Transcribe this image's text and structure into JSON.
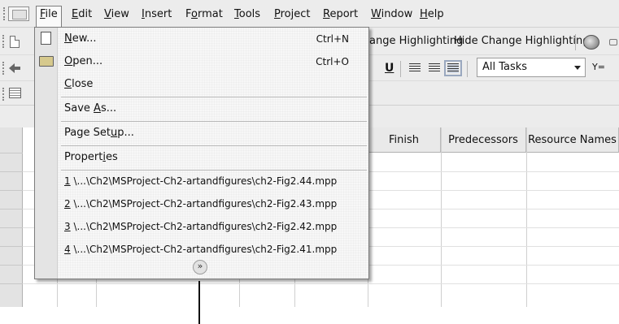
{
  "menubar": {
    "items": [
      {
        "label": "File",
        "underline": "F",
        "rest": "ile"
      },
      {
        "label": "Edit",
        "underline": "E",
        "rest": "dit"
      },
      {
        "label": "View",
        "underline": "V",
        "rest": "iew"
      },
      {
        "label": "Insert",
        "underline": "I",
        "rest": "nsert"
      },
      {
        "label": "Format",
        "pre": "F",
        "underline": "o",
        "rest": "rmat"
      },
      {
        "label": "Tools",
        "underline": "T",
        "rest": "ools"
      },
      {
        "label": "Project",
        "underline": "P",
        "rest": "roject"
      },
      {
        "label": "Report",
        "underline": "R",
        "rest": "eport"
      },
      {
        "label": "Window",
        "underline": "W",
        "rest": "indow"
      },
      {
        "label": "Help",
        "underline": "H",
        "rest": "elp"
      }
    ]
  },
  "toolbar1": {
    "change_highlight_partial": "ange Highlighting",
    "hide_change_highlight": "Hide Change Highlighting"
  },
  "toolbar2": {
    "filter_value": "All Tasks",
    "filter_icon_text": "Y="
  },
  "table": {
    "headers": [
      "Finish",
      "Predecessors",
      "Resource Names"
    ]
  },
  "file_menu": {
    "items": [
      {
        "label": "New...",
        "u": "N",
        "rest": "ew...",
        "shortcut": "Ctrl+N"
      },
      {
        "label": "Open...",
        "u": "O",
        "rest": "pen...",
        "shortcut": "Ctrl+O"
      },
      {
        "label": "Close",
        "u": "C",
        "rest": "lose"
      },
      {
        "label": "Save As...",
        "pre": "Save ",
        "u": "A",
        "rest": "s..."
      },
      {
        "label": "Page Setup...",
        "pre": "Page Set",
        "u": "u",
        "rest": "p..."
      },
      {
        "label": "Properties",
        "pre": "Propert",
        "u": "i",
        "rest": "es"
      }
    ],
    "recent": [
      {
        "num": "1",
        "path": " \\...\\Ch2\\MSProject-Ch2-artandfigures\\ch2-Fig2.44.mpp"
      },
      {
        "num": "2",
        "path": " \\...\\Ch2\\MSProject-Ch2-artandfigures\\ch2-Fig2.43.mpp"
      },
      {
        "num": "3",
        "path": " \\...\\Ch2\\MSProject-Ch2-artandfigures\\ch2-Fig2.42.mpp"
      },
      {
        "num": "4",
        "path": " \\...\\Ch2\\MSProject-Ch2-artandfigures\\ch2-Fig2.41.mpp"
      }
    ],
    "expand_glyph": "»"
  }
}
